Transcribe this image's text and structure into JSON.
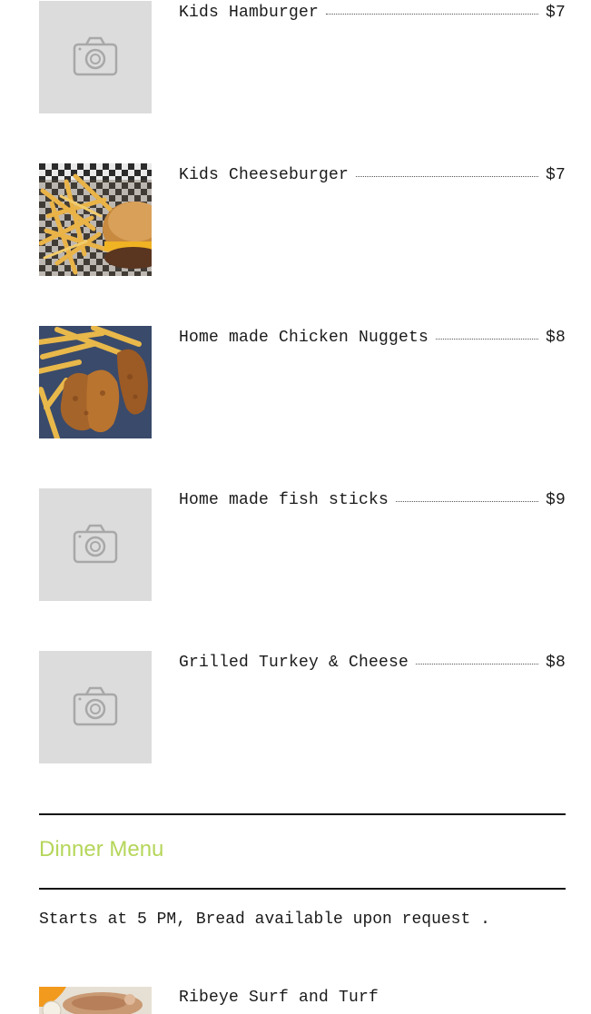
{
  "kids_menu": {
    "items": [
      {
        "name": "Kids Hamburger",
        "price": "$7",
        "image": "placeholder-camera-icon"
      },
      {
        "name": "Kids Cheeseburger",
        "price": "$7",
        "image": "cheeseburger-fries-photo"
      },
      {
        "name": "Home made Chicken Nuggets",
        "price": "$8",
        "image": "chicken-nuggets-fries-photo"
      },
      {
        "name": "Home made fish sticks",
        "price": "$9",
        "image": "placeholder-camera-icon"
      },
      {
        "name": "Grilled Turkey & Cheese",
        "price": "$8",
        "image": "placeholder-camera-icon"
      }
    ]
  },
  "dinner_menu": {
    "title": "Dinner Menu",
    "note": "Starts at 5 PM, Bread available upon request .",
    "title_color": "#b5d65a",
    "first_item": {
      "name": "Ribeye Surf and Turf",
      "image": "surf-and-turf-photo"
    }
  }
}
